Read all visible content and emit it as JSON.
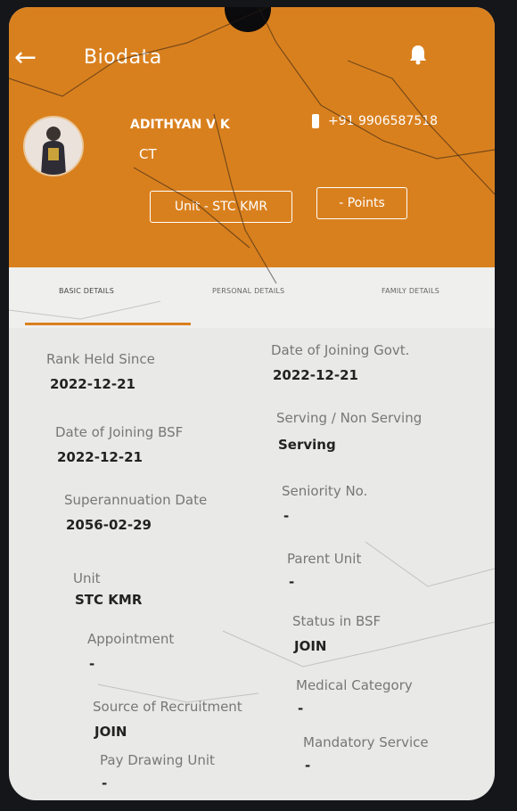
{
  "header": {
    "title": "Biodata",
    "back_icon": "back-arrow-icon",
    "bell_icon": "bell-icon"
  },
  "profile": {
    "name": "ADITHYAN V K",
    "rank": "CT",
    "phone": "+91 9906587518",
    "unit_button": "Unit - STC KMR",
    "points_button": "- Points"
  },
  "tabs": [
    {
      "label": "BASIC DETAILS",
      "active": true
    },
    {
      "label": "PERSONAL DETAILS",
      "active": false
    },
    {
      "label": "FAMILY DETAILS",
      "active": false
    }
  ],
  "left_fields": [
    {
      "label": "Rank Held Since",
      "value": "2022-12-21"
    },
    {
      "label": "Date of Joining BSF",
      "value": "2022-12-21"
    },
    {
      "label": "Superannuation Date",
      "value": "2056-02-29"
    },
    {
      "label": "Unit",
      "value": "STC KMR"
    },
    {
      "label": "Appointment",
      "value": "-"
    },
    {
      "label": "Source of Recruitment",
      "value": "JOIN"
    },
    {
      "label": "Pay Drawing Unit",
      "value": "-"
    }
  ],
  "right_fields": [
    {
      "label": "Date of Joining Govt.",
      "value": "2022-12-21"
    },
    {
      "label": "Serving / Non Serving",
      "value": "Serving"
    },
    {
      "label": "Seniority No.",
      "value": "-"
    },
    {
      "label": "Parent Unit",
      "value": "-"
    },
    {
      "label": "Status in BSF",
      "value": "JOIN"
    },
    {
      "label": "Medical Category",
      "value": "-"
    },
    {
      "label": "Mandatory Service",
      "value": "-"
    }
  ],
  "colors": {
    "accent": "#d9801e",
    "background": "#e9e9e7"
  }
}
